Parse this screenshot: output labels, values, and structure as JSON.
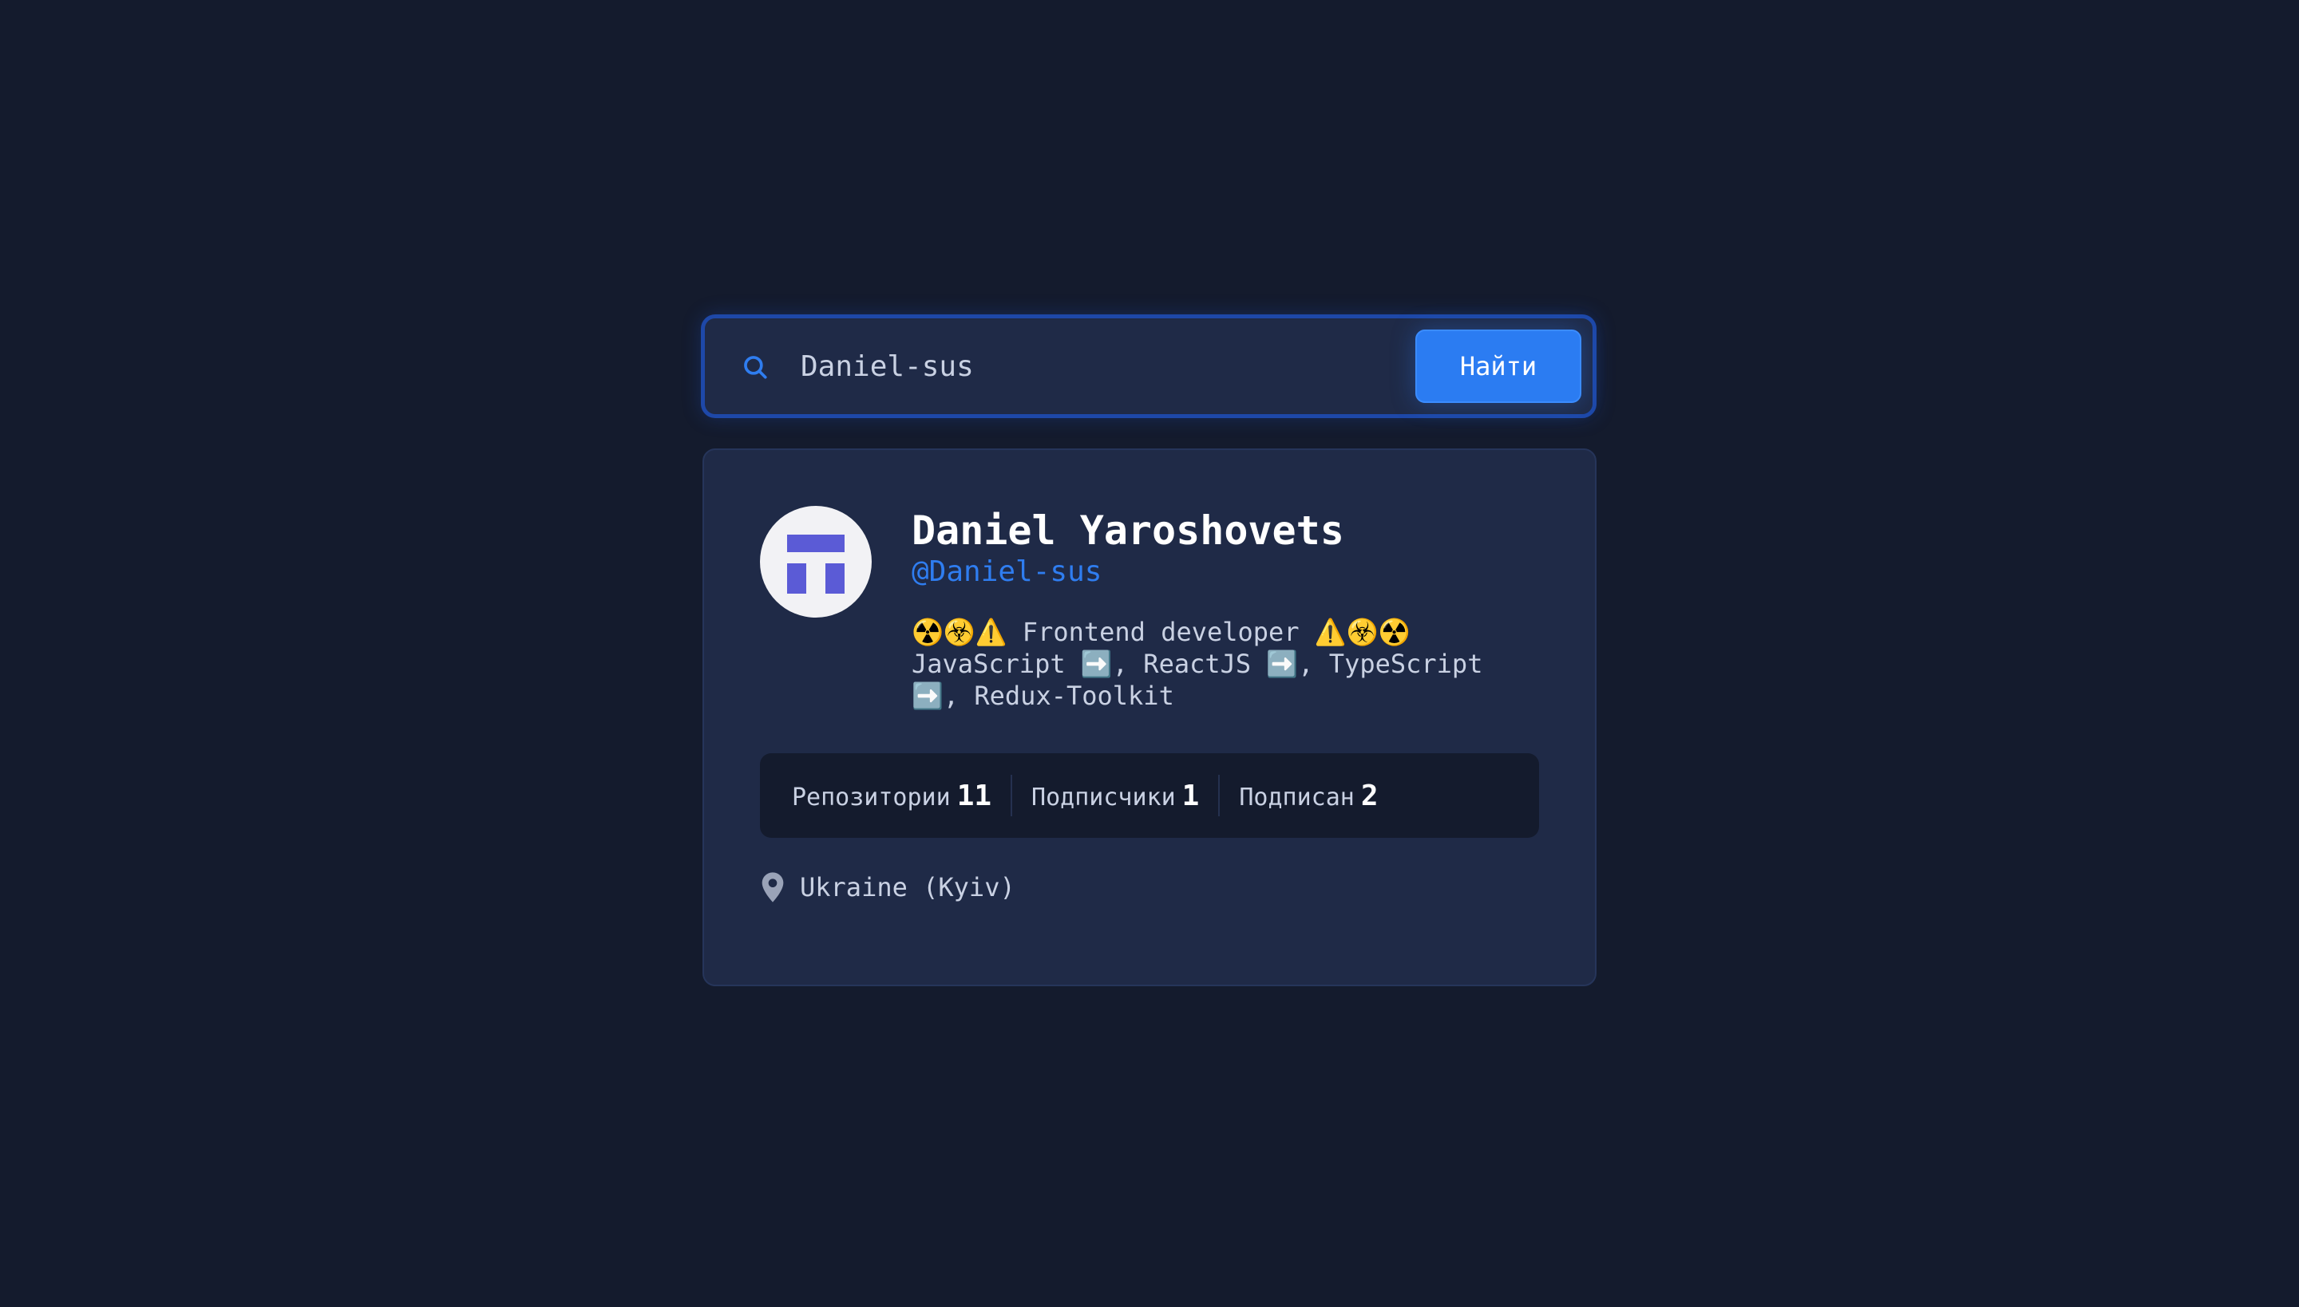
{
  "search": {
    "value": "Daniel-sus",
    "placeholder": "",
    "button_label": "Найти",
    "icon": "search-icon"
  },
  "profile": {
    "name": "Daniel Yaroshovets",
    "login": "@Daniel-sus",
    "bio": "☢️☣️⚠️ Frontend developer ⚠️☣️☢️\nJavaScript ➡️, ReactJS ➡️, TypeScript\n➡️, Redux-Toolkit",
    "avatar_icon": "identicon-avatar"
  },
  "stats": {
    "repos_label": "Репозитории",
    "repos_value": "11",
    "followers_label": "Подписчики",
    "followers_value": "1",
    "following_label": "Подписан",
    "following_value": "2"
  },
  "location": {
    "icon": "map-pin-icon",
    "text": "Ukraine (Kyiv)"
  },
  "colors": {
    "background": "#141b2d",
    "card": "#1f2a47",
    "accent": "#2b7cf2",
    "link": "#2f7df0",
    "avatar_mark": "#5b5bd6"
  }
}
